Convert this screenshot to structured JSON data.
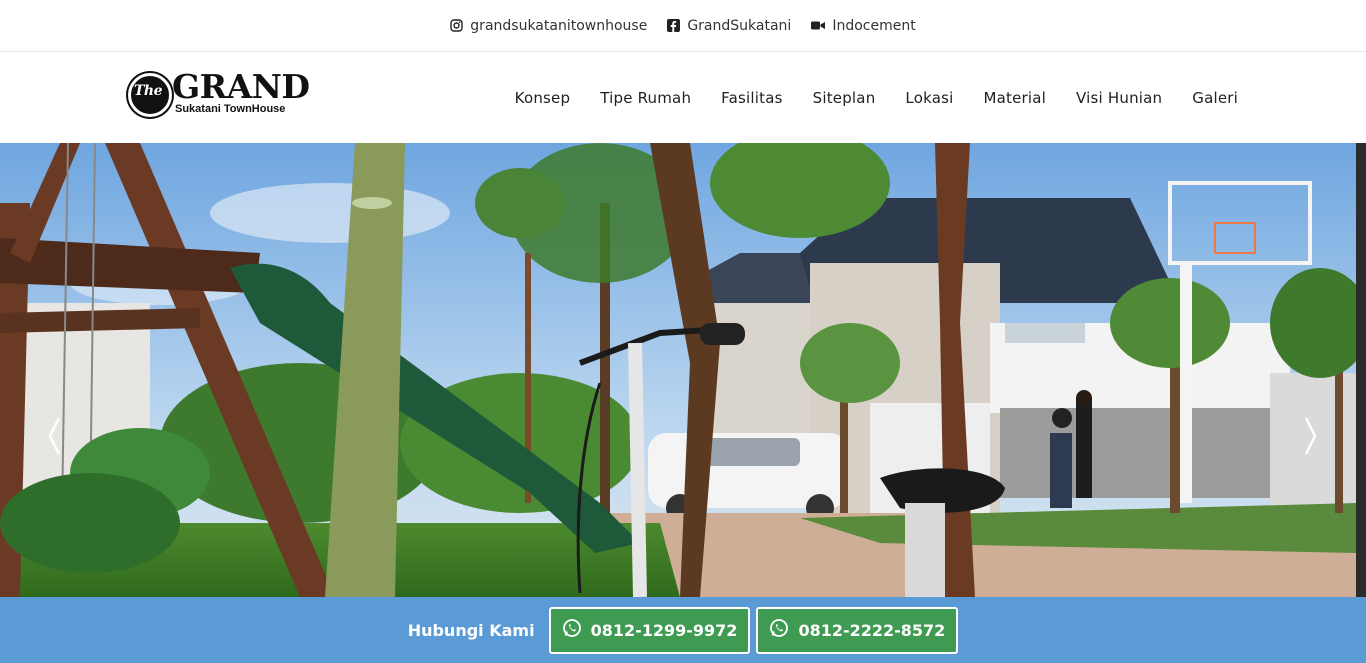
{
  "topbar": {
    "instagram": {
      "icon": "instagram-icon",
      "label": "grandsukatanitownhouse"
    },
    "facebook": {
      "icon": "facebook-icon",
      "label": "GrandSukatani"
    },
    "video": {
      "icon": "video-camera-icon",
      "label": "Indocement"
    }
  },
  "logo": {
    "badge": "The",
    "word": "GRAND",
    "subtitle": "Sukatani TownHouse"
  },
  "nav": {
    "items": [
      {
        "label": "Konsep"
      },
      {
        "label": "Tipe Rumah"
      },
      {
        "label": "Fasilitas"
      },
      {
        "label": "Siteplan"
      },
      {
        "label": "Lokasi"
      },
      {
        "label": "Material"
      },
      {
        "label": "Visi Hunian"
      },
      {
        "label": "Galeri"
      }
    ]
  },
  "hero": {
    "prev_icon": "chevron-left-icon",
    "next_icon": "chevron-right-icon"
  },
  "contact": {
    "label": "Hubungi Kami",
    "buttons": [
      {
        "icon": "whatsapp-icon",
        "phone": "0812-1299-9972"
      },
      {
        "icon": "whatsapp-icon",
        "phone": "0812-2222-8572"
      }
    ]
  },
  "colors": {
    "contact_bar": "#5b9bd5",
    "whatsapp_green": "#3f9a52",
    "text_dark": "#222222"
  }
}
